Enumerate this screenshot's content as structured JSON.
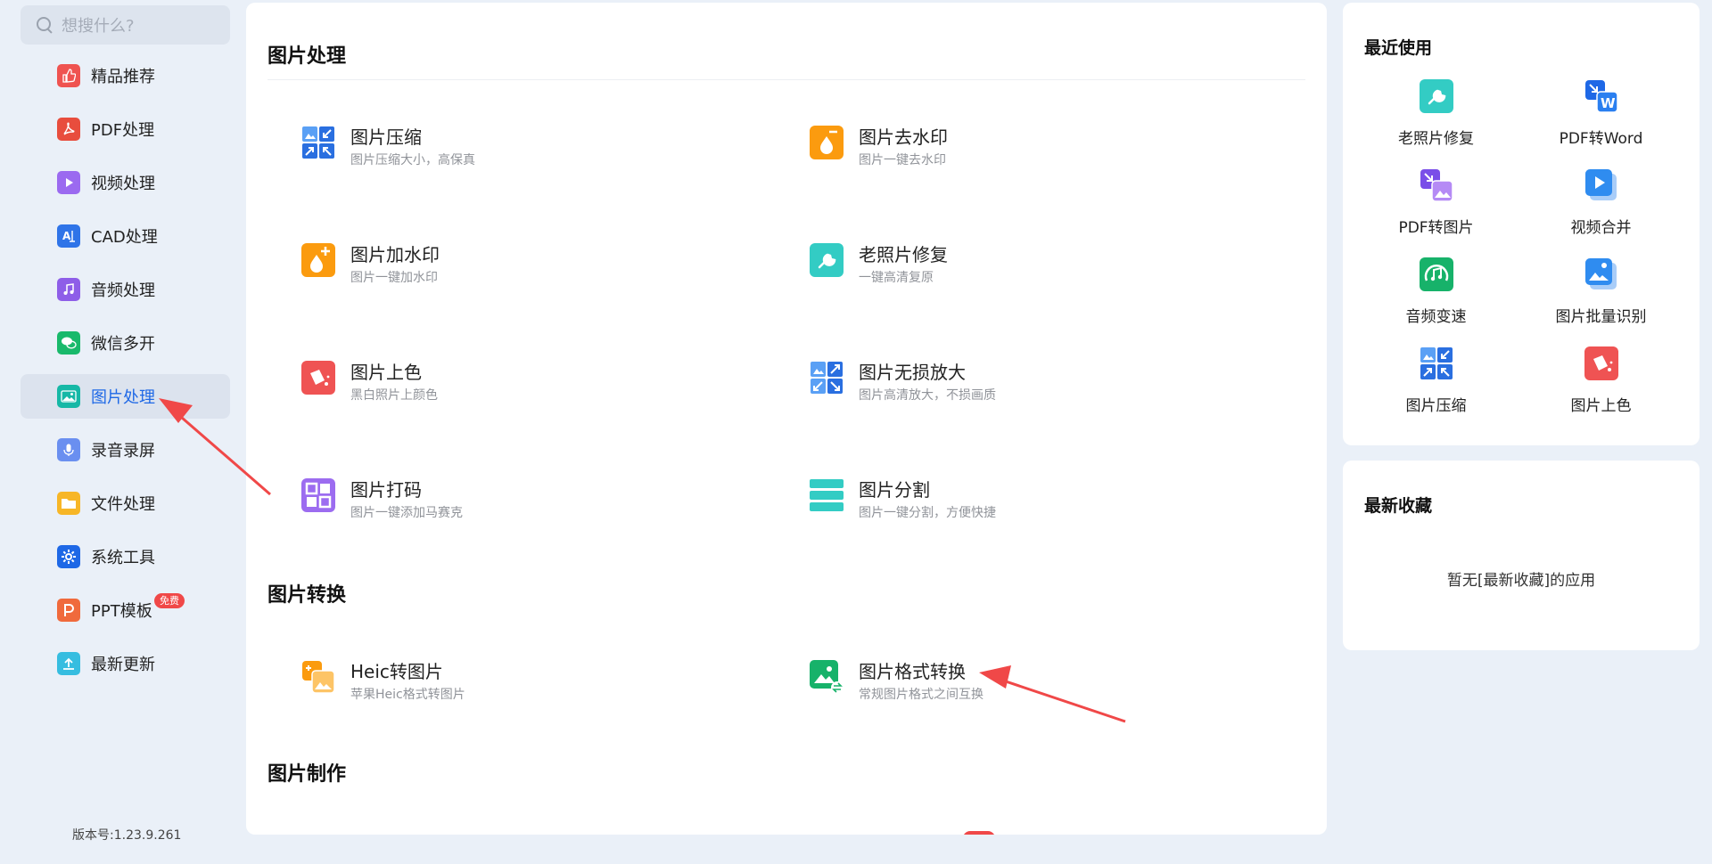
{
  "search": {
    "placeholder": "想搜什么?"
  },
  "sidebar": {
    "items": [
      {
        "label": "精品推荐",
        "icon": "thumbs-up-icon"
      },
      {
        "label": "PDF处理",
        "icon": "pdf-icon"
      },
      {
        "label": "视频处理",
        "icon": "video-play-icon"
      },
      {
        "label": "CAD处理",
        "icon": "cad-icon"
      },
      {
        "label": "音频处理",
        "icon": "music-note-icon"
      },
      {
        "label": "微信多开",
        "icon": "wechat-icon"
      },
      {
        "label": "图片处理",
        "icon": "image-icon",
        "active": true
      },
      {
        "label": "录音录屏",
        "icon": "microphone-icon"
      },
      {
        "label": "文件处理",
        "icon": "folder-icon"
      },
      {
        "label": "系统工具",
        "icon": "gear-icon"
      },
      {
        "label": "PPT模板",
        "icon": "ppt-icon",
        "badge": "免费"
      },
      {
        "label": "最新更新",
        "icon": "upload-icon"
      }
    ],
    "version": "版本号:1.23.9.261"
  },
  "main": {
    "sections": [
      {
        "title": "图片处理"
      },
      {
        "title": "图片转换"
      },
      {
        "title": "图片制作"
      }
    ],
    "tools": [
      {
        "name": "图片压缩",
        "desc": "图片压缩大小，高保真",
        "icon": "image-compress-icon"
      },
      {
        "name": "图片去水印",
        "desc": "图片一键去水印",
        "icon": "remove-watermark-icon"
      },
      {
        "name": "图片加水印",
        "desc": "图片一键加水印",
        "icon": "add-watermark-icon"
      },
      {
        "name": "老照片修复",
        "desc": "一键高清复原",
        "icon": "photo-repair-icon"
      },
      {
        "name": "图片上色",
        "desc": "黑白照片上颜色",
        "icon": "colorize-icon"
      },
      {
        "name": "图片无损放大",
        "desc": "图片高清放大，不损画质",
        "icon": "upscale-icon"
      },
      {
        "name": "图片打码",
        "desc": "图片一键添加马赛克",
        "icon": "mosaic-icon"
      },
      {
        "name": "图片分割",
        "desc": "图片一键分割，方便快捷",
        "icon": "split-icon"
      },
      {
        "name": "Heic转图片",
        "desc": "苹果Heic格式转图片",
        "icon": "heic-convert-icon"
      },
      {
        "name": "图片格式转换",
        "desc": "常规图片格式之间互换",
        "icon": "format-convert-icon"
      }
    ]
  },
  "recent": {
    "title": "最近使用",
    "items": [
      {
        "label": "老照片修复",
        "icon": "photo-repair-icon"
      },
      {
        "label": "PDF转Word",
        "icon": "pdf-to-word-icon"
      },
      {
        "label": "PDF转图片",
        "icon": "pdf-to-image-icon"
      },
      {
        "label": "视频合并",
        "icon": "video-merge-icon"
      },
      {
        "label": "音频变速",
        "icon": "audio-speed-icon"
      },
      {
        "label": "图片批量识别",
        "icon": "image-batch-ocr-icon"
      },
      {
        "label": "图片压缩",
        "icon": "image-compress-icon"
      },
      {
        "label": "图片上色",
        "icon": "colorize-icon"
      }
    ]
  },
  "favorites": {
    "title": "最新收藏",
    "empty_text": "暂无[最新收藏]的应用"
  },
  "colors": {
    "accent": "#1e68e6",
    "annotation_red": "#f04848"
  }
}
